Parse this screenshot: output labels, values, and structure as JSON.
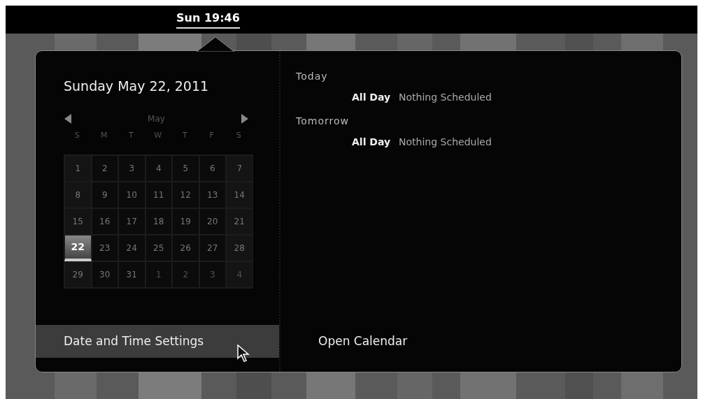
{
  "top_bar": {
    "clock": "Sun 19:46"
  },
  "date_heading": "Sunday May 22, 2011",
  "calendar": {
    "month": "May",
    "weekdays": [
      "S",
      "M",
      "T",
      "W",
      "T",
      "F",
      "S"
    ],
    "days": [
      {
        "label": "1",
        "selected": false,
        "other_month": false
      },
      {
        "label": "2",
        "selected": false,
        "other_month": false
      },
      {
        "label": "3",
        "selected": false,
        "other_month": false
      },
      {
        "label": "4",
        "selected": false,
        "other_month": false
      },
      {
        "label": "5",
        "selected": false,
        "other_month": false
      },
      {
        "label": "6",
        "selected": false,
        "other_month": false
      },
      {
        "label": "7",
        "selected": false,
        "other_month": false
      },
      {
        "label": "8",
        "selected": false,
        "other_month": false
      },
      {
        "label": "9",
        "selected": false,
        "other_month": false
      },
      {
        "label": "10",
        "selected": false,
        "other_month": false
      },
      {
        "label": "11",
        "selected": false,
        "other_month": false
      },
      {
        "label": "12",
        "selected": false,
        "other_month": false
      },
      {
        "label": "13",
        "selected": false,
        "other_month": false
      },
      {
        "label": "14",
        "selected": false,
        "other_month": false
      },
      {
        "label": "15",
        "selected": false,
        "other_month": false
      },
      {
        "label": "16",
        "selected": false,
        "other_month": false
      },
      {
        "label": "17",
        "selected": false,
        "other_month": false
      },
      {
        "label": "18",
        "selected": false,
        "other_month": false
      },
      {
        "label": "19",
        "selected": false,
        "other_month": false
      },
      {
        "label": "20",
        "selected": false,
        "other_month": false
      },
      {
        "label": "21",
        "selected": false,
        "other_month": false
      },
      {
        "label": "22",
        "selected": true,
        "other_month": false
      },
      {
        "label": "23",
        "selected": false,
        "other_month": false
      },
      {
        "label": "24",
        "selected": false,
        "other_month": false
      },
      {
        "label": "25",
        "selected": false,
        "other_month": false
      },
      {
        "label": "26",
        "selected": false,
        "other_month": false
      },
      {
        "label": "27",
        "selected": false,
        "other_month": false
      },
      {
        "label": "28",
        "selected": false,
        "other_month": false
      },
      {
        "label": "29",
        "selected": false,
        "other_month": false
      },
      {
        "label": "30",
        "selected": false,
        "other_month": false
      },
      {
        "label": "31",
        "selected": false,
        "other_month": false
      },
      {
        "label": "1",
        "selected": false,
        "other_month": true
      },
      {
        "label": "2",
        "selected": false,
        "other_month": true
      },
      {
        "label": "3",
        "selected": false,
        "other_month": true
      },
      {
        "label": "4",
        "selected": false,
        "other_month": true
      }
    ]
  },
  "agenda": [
    {
      "heading": "Today",
      "events": [
        {
          "time": "All Day",
          "title": "Nothing Scheduled"
        }
      ]
    },
    {
      "heading": "Tomorrow",
      "events": [
        {
          "time": "All Day",
          "title": "Nothing Scheduled"
        }
      ]
    }
  ],
  "actions": [
    {
      "label": "Date and Time Settings",
      "hovered": true
    },
    {
      "label": "Open Calendar",
      "hovered": false
    }
  ]
}
